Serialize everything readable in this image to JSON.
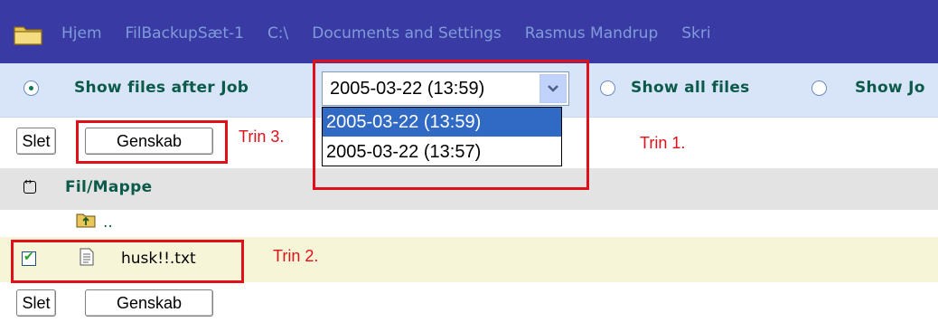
{
  "breadcrumb": {
    "items": [
      "Hjem",
      "FilBackupSæt-1",
      "C:\\",
      "Documents and Settings",
      "Rasmus Mandrup",
      "Skri"
    ]
  },
  "options": {
    "show_after_job": "Show files after Job",
    "show_all": "Show all files",
    "show_jobs": "Show Jo",
    "selected_radio": "show_after_job"
  },
  "job_select": {
    "value": "2005-03-22 (13:59)",
    "options": [
      "2005-03-22 (13:59)",
      "2005-03-22 (13:57)"
    ],
    "highlighted": "2005-03-22 (13:59)"
  },
  "actions": {
    "delete": "Slet",
    "restore": "Genskab"
  },
  "table": {
    "header": "Fil/Mappe",
    "parent": "..",
    "rows": [
      {
        "name": "husk!!.txt",
        "checked": true
      }
    ]
  },
  "annotations": {
    "step1": "Trin 1.",
    "step2": "Trin 2.",
    "step3": "Trin 3."
  },
  "colors": {
    "breadcrumb_bg": "#3a3aa5",
    "breadcrumb_text": "#7f9cd8",
    "label_green": "#0b5a4a",
    "annotation_red": "#e0101a",
    "selection_blue": "#316ac5"
  }
}
